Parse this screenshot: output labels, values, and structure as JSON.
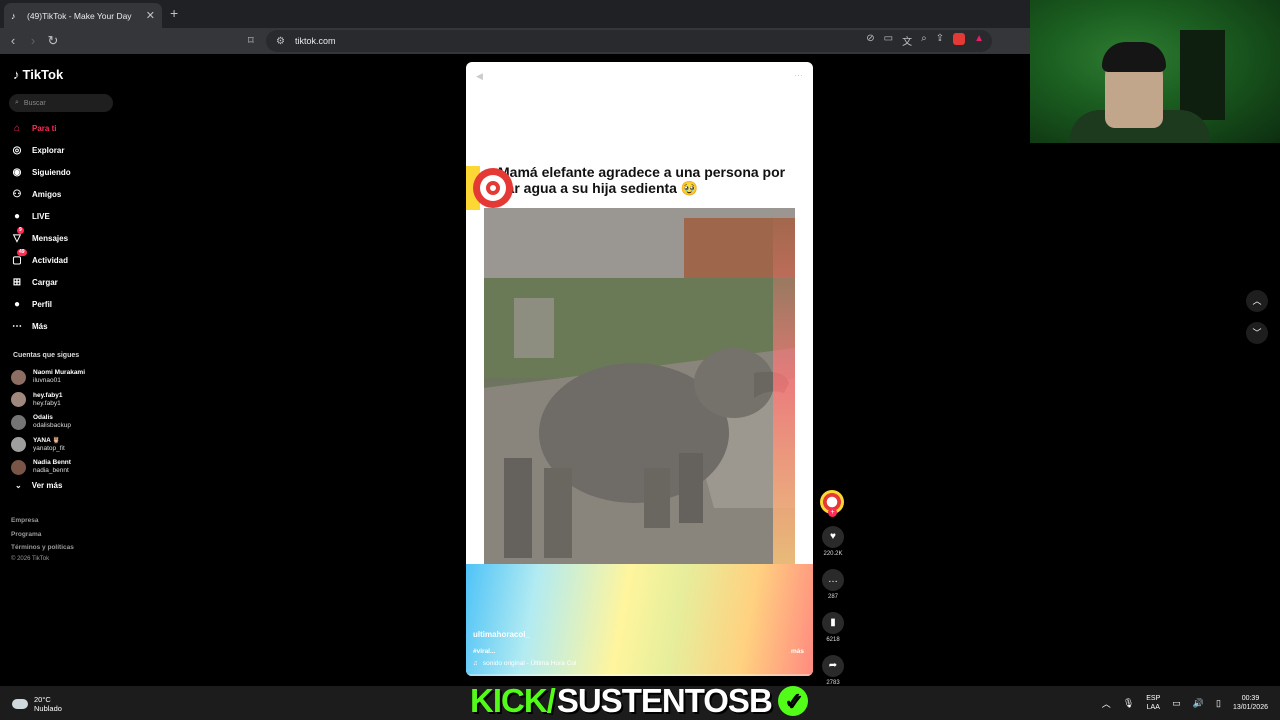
{
  "browser": {
    "tab_title": "(49)TikTok - Make Your Day",
    "url": "tiktok.com"
  },
  "sidebar": {
    "logo": "TikTok",
    "search_placeholder": "Buscar",
    "nav": [
      {
        "label": "Para ti",
        "icon": "home-icon",
        "active": true
      },
      {
        "label": "Explorar",
        "icon": "compass-icon"
      },
      {
        "label": "Siguiendo",
        "icon": "following-icon"
      },
      {
        "label": "Amigos",
        "icon": "friends-icon"
      },
      {
        "label": "LIVE",
        "icon": "live-icon"
      },
      {
        "label": "Mensajes",
        "icon": "messages-icon",
        "badge": "9"
      },
      {
        "label": "Actividad",
        "icon": "activity-icon",
        "badge": "49"
      },
      {
        "label": "Cargar",
        "icon": "upload-icon"
      },
      {
        "label": "Perfil",
        "icon": "profile-icon"
      },
      {
        "label": "Más",
        "icon": "more-icon"
      }
    ],
    "following_title": "Cuentas que sigues",
    "accounts": [
      {
        "name": "Naomi Murakami",
        "user": "iluvnao01"
      },
      {
        "name": "hey.faby1",
        "user": "hey.faby1"
      },
      {
        "name": "Odalis",
        "user": "odalisbackup"
      },
      {
        "name": "YANA 🦉",
        "user": "yanatop_fit"
      },
      {
        "name": "Nadia Bennt",
        "user": "nadia_bennt"
      }
    ],
    "see_more": "Ver más",
    "footer": [
      "Empresa",
      "Programa",
      "Términos y políticas"
    ],
    "copyright": "© 2026 TikTok"
  },
  "video": {
    "caption": "Mamá elefante agradece a una persona por dar agua a su hija sedienta 🥹",
    "username": "ultimahoracol_",
    "hashtag": "#viral...",
    "more": "más",
    "sound": "sonido original - Última Hora Col"
  },
  "actions": {
    "likes": "220.2K",
    "comments": "287",
    "saves": "6218",
    "shares": "2783"
  },
  "taskbar": {
    "temp": "20°C",
    "weather": "Nublado",
    "overlay_kick": "KICK/",
    "overlay_name": "SUSTENTOSB",
    "lang_1": "ESP",
    "lang_2": "LAA",
    "time": "00:39",
    "date": "13/01/2026"
  }
}
